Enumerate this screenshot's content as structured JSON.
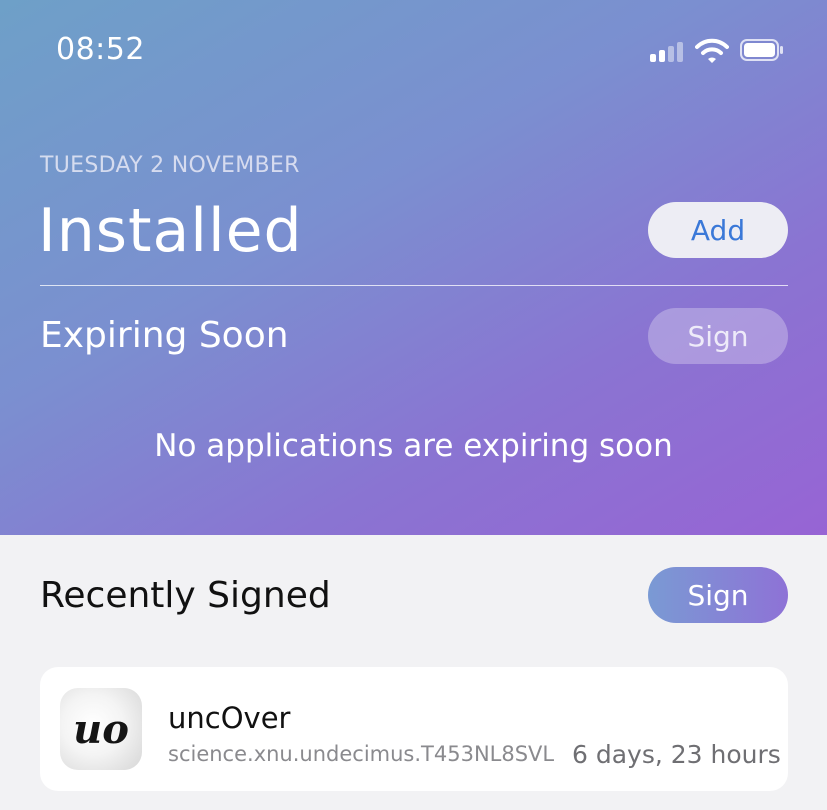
{
  "status_bar": {
    "time": "08:52"
  },
  "header": {
    "date": "TUESDAY 2 NOVEMBER",
    "title": "Installed",
    "add_label": "Add"
  },
  "expiring": {
    "heading": "Expiring Soon",
    "sign_label": "Sign",
    "empty_message": "No applications are expiring soon"
  },
  "recent": {
    "heading": "Recently Signed",
    "sign_label": "Sign",
    "apps": [
      {
        "icon_text": "uo",
        "name": "uncOver",
        "bundle_id": "science.xnu.undecimus.T453NL8SVL",
        "expires_in": "6 days, 23 hours"
      }
    ]
  },
  "colors": {
    "accent": "#3a78d8",
    "gradient_start": "#6ea0c8",
    "gradient_end": "#9764d4",
    "background": "#f2f2f4"
  },
  "icons": [
    "cellular-signal-icon",
    "wifi-icon",
    "battery-icon",
    "app-icon-uncover"
  ]
}
